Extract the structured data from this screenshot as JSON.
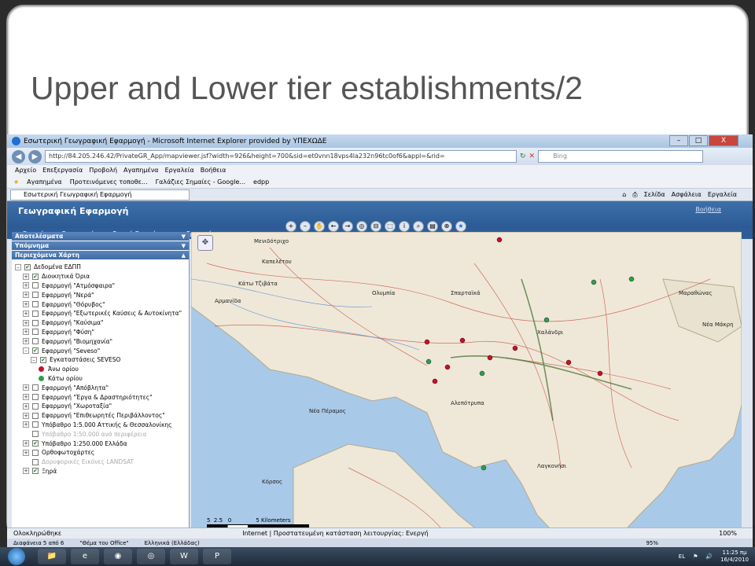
{
  "slide": {
    "title": "Upper and Lower tier establishments/2"
  },
  "ie": {
    "window_title": "Εσωτερική Γεωγραφική Εφαρμογή - Microsoft Internet Explorer provided by ΥΠΕΧΩΔΕ",
    "window_controls": [
      "–",
      "□",
      "X"
    ],
    "url": "http://84.205.246.42/PrivateGR_App/mapviewer.jsf?width=926&height=700&sid=et0vnn18vps4la232n96tc0of6&appl=&rid=",
    "search_placeholder": "Bing",
    "menu": [
      "Αρχείο",
      "Επεξεργασία",
      "Προβολή",
      "Αγαπημένα",
      "Εργαλεία",
      "Βοήθεια"
    ],
    "favorites": [
      "Αγαπημένα",
      "Προτεινόμενες τοποθε...",
      "Γαλάζιες Σημαίες - Google...",
      "edpp"
    ],
    "tab_label": "Εσωτερική Γεωγραφική Εφαρμογή",
    "commands": [
      "Σελίδα",
      "Ασφάλεια",
      "Εργαλεία"
    ],
    "status_left": "Ολοκληρώθηκε",
    "status_zone": "Internet | Προστατευμένη κατάσταση λειτουργίας: Ενεργή",
    "zoom": "100%"
  },
  "app": {
    "title": "Γεωγραφική Εφαρμογή",
    "help": "Βοήθεια",
    "menu": [
      "Ερωτήματα Εφαρμογών",
      "Γενικά Ερωτήματα",
      "Γραφικά"
    ],
    "panels": [
      "Αποτελέσματα",
      "Υπόμνημα",
      "Περιεχόμενα Χάρτη"
    ],
    "tree": [
      {
        "label": "Δεδομένα ΕΔΠΠ",
        "checked": true,
        "pm": "–",
        "indent": 0
      },
      {
        "label": "Διοικητικά Όρια",
        "checked": true,
        "pm": "+",
        "indent": 1
      },
      {
        "label": "Εφαρμογή \"Ατμόσφαιρα\"",
        "checked": false,
        "pm": "+",
        "indent": 1
      },
      {
        "label": "Εφαρμογή \"Νερά\"",
        "checked": false,
        "pm": "+",
        "indent": 1
      },
      {
        "label": "Εφαρμογή \"Θόρυβος\"",
        "checked": false,
        "pm": "+",
        "indent": 1
      },
      {
        "label": "Εφαρμογή \"Εξωτερικές Καύσεις & Αυτοκίνητα\"",
        "checked": false,
        "pm": "+",
        "indent": 1
      },
      {
        "label": "Εφαρμογή \"Καύσιμα\"",
        "checked": false,
        "pm": "+",
        "indent": 1
      },
      {
        "label": "Εφαρμογή \"Φύση\"",
        "checked": false,
        "pm": "+",
        "indent": 1
      },
      {
        "label": "Εφαρμογή \"Βιομηχανία\"",
        "checked": false,
        "pm": "+",
        "indent": 1
      },
      {
        "label": "Εφαρμογή \"Seveso\"",
        "checked": true,
        "pm": "–",
        "indent": 1
      },
      {
        "label": "Εγκαταστάσεις SEVESO",
        "checked": true,
        "pm": "–",
        "indent": 2
      },
      {
        "label": "Άνω ορίου",
        "dot": "#c8102e",
        "indent": 3
      },
      {
        "label": "Κάτω ορίου",
        "dot": "#2ea043",
        "indent": 3
      },
      {
        "label": "Εφαρμογή \"Απόβλητα\"",
        "checked": false,
        "pm": "+",
        "indent": 1
      },
      {
        "label": "Εφαρμογή \"Έργα & Δραστηριότητες\"",
        "checked": false,
        "pm": "+",
        "indent": 1
      },
      {
        "label": "Εφαρμογή \"Χωροταξία\"",
        "checked": false,
        "pm": "+",
        "indent": 1
      },
      {
        "label": "Εφαρμογή \"Επιθεωρητές Περιβάλλοντος\"",
        "checked": false,
        "pm": "+",
        "indent": 1
      },
      {
        "label": "Υπόβαθρο 1:5.000 Αττικής & Θεσσαλονίκης",
        "checked": false,
        "pm": "+",
        "indent": 1
      },
      {
        "label": "Υπόβαθρο 1:50.000 ανά περιφέρεια",
        "checked": false,
        "pm": "",
        "indent": 1,
        "dim": true
      },
      {
        "label": "Υπόβαθρο 1:250.000 Ελλάδα",
        "checked": true,
        "pm": "+",
        "indent": 1
      },
      {
        "label": "Ορθοφωτοχάρτες",
        "checked": false,
        "pm": "+",
        "indent": 1
      },
      {
        "label": "Δορυφορικές Εικόνες LANDSAT",
        "checked": false,
        "pm": "",
        "indent": 1,
        "dim": true
      },
      {
        "label": "Ξηρά",
        "checked": true,
        "pm": "+",
        "indent": 1
      }
    ],
    "scale_labels": [
      "5",
      "2.5",
      "0",
      "5 Kilometers"
    ],
    "map_labels": [
      "Μενιδότριχο",
      "Καπελέτου",
      "Κάτω Τζιβάτα",
      "Αρμανίδα",
      "Ολυμπία",
      "Σπαρταϊκά",
      "Χαλάνδρι",
      "Μαραθώνας",
      "Νέα Μάκρη",
      "Λαγκονήσι",
      "Αλεπότρυπα",
      "Κόρσος",
      "Νέα Πέραμος"
    ],
    "pptstatus": [
      "Διαφάνεια 5 από 6",
      "\"Θέμα του Office\"",
      "Ελληνικά (Ελλάδας)"
    ],
    "ppt_zoom": "95%"
  },
  "taskbar": {
    "lang": "EL",
    "time": "11:25 πμ",
    "date": "16/4/2010"
  }
}
